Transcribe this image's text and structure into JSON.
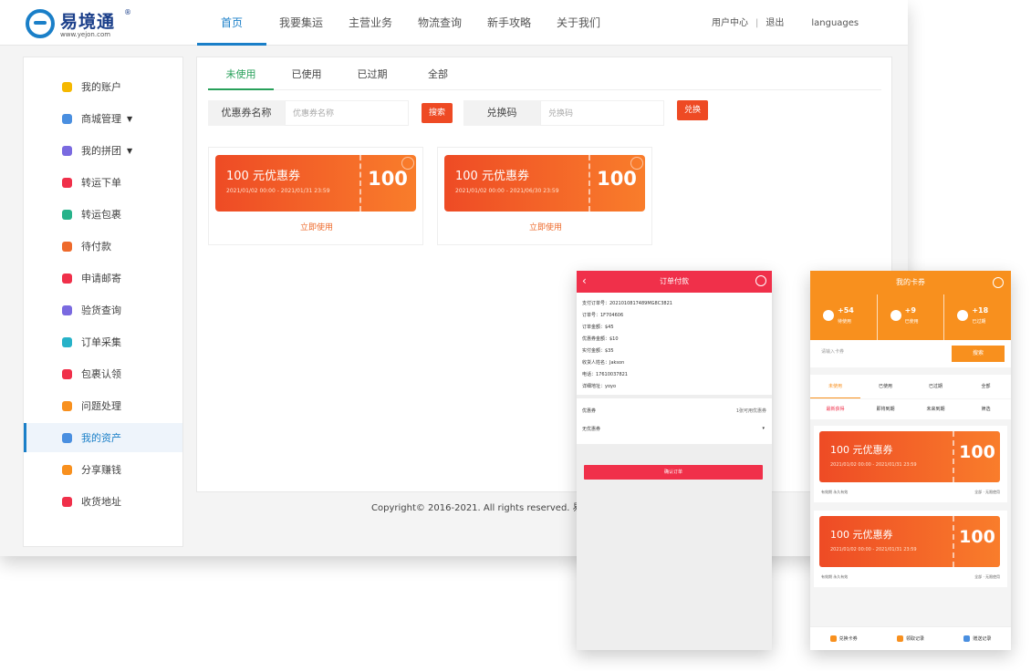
{
  "colors": {
    "brand": "#1a7fc8",
    "active_tab": "#27a05a",
    "accent_red": "#ee4a24",
    "mobile_red": "#f0304a",
    "mobile_orange": "#f8901e"
  },
  "header": {
    "logo_text": "易境通",
    "logo_reg": "®",
    "logo_url": "www.yejon.com",
    "nav": [
      "首页",
      "我要集运",
      "主营业务",
      "物流查询",
      "新手攻略",
      "关于我们"
    ],
    "user_center": "用户中心",
    "separator": "|",
    "logout": "退出",
    "languages": "languages"
  },
  "sidebar": {
    "items": [
      {
        "label": "我的账户",
        "icon": "user-icon",
        "color": "#f5b800"
      },
      {
        "label": "商城管理",
        "icon": "shop-icon",
        "color": "#4a8fe0",
        "dropdown": "▼"
      },
      {
        "label": "我的拼团",
        "icon": "group-icon",
        "color": "#7a6ae0",
        "dropdown": "▼"
      },
      {
        "label": "转运下单",
        "icon": "order-icon",
        "color": "#f0304a"
      },
      {
        "label": "转运包裹",
        "icon": "package-icon",
        "color": "#27b28a"
      },
      {
        "label": "待付款",
        "icon": "payment-icon",
        "color": "#ee6a2b"
      },
      {
        "label": "申请邮寄",
        "icon": "mail-icon",
        "color": "#f0304a"
      },
      {
        "label": "验货查询",
        "icon": "inspect-icon",
        "color": "#7a6ae0"
      },
      {
        "label": "订单采集",
        "icon": "collect-icon",
        "color": "#27b2c8"
      },
      {
        "label": "包裹认领",
        "icon": "claim-icon",
        "color": "#f0304a"
      },
      {
        "label": "问题处理",
        "icon": "issue-icon",
        "color": "#f8901e"
      },
      {
        "label": "我的资产",
        "icon": "assets-icon",
        "color": "#4a8fe0"
      },
      {
        "label": "分享赚钱",
        "icon": "share-icon",
        "color": "#f8901e"
      },
      {
        "label": "收货地址",
        "icon": "address-icon",
        "color": "#f0304a"
      }
    ]
  },
  "coupons_page": {
    "tabs": [
      "未使用",
      "已使用",
      "已过期",
      "全部"
    ],
    "search_label": "优惠券名称",
    "search_placeholder": "优惠券名称",
    "search_button": "搜索",
    "redeem_label": "兑换码",
    "redeem_placeholder": "兑换码",
    "redeem_button": "兑换",
    "cards": [
      {
        "title": "100 元优惠券",
        "date": "2021/01/02 00:00 - 2021/01/31 23:59",
        "value": "100",
        "action": "立即使用"
      },
      {
        "title": "100 元优惠券",
        "date": "2021/01/02 00:00 - 2021/06/30 23:59",
        "value": "100",
        "action": "立即使用"
      }
    ]
  },
  "footer": {
    "copyright": "Copyright© 2016-2021. All rights reserved. 易境"
  },
  "mobile_order": {
    "title": "订单付款",
    "back": "‹",
    "rows": [
      "支付订单号：2021010817489MG8C3821",
      "订单号：1F704606",
      "订单金额：$45",
      "优惠券金额：$10",
      "实付金额：$35",
      "收货人姓名：Jakson",
      "电话：17610037821",
      "详细地址：yoyo"
    ],
    "coupon_label": "优惠券",
    "coupon_hint": "1张可用优惠券",
    "select_value": "无优惠券",
    "select_arrow": "▾",
    "confirm_button": "确认订单"
  },
  "mobile_coupons": {
    "title": "我的卡券",
    "stats": [
      {
        "value": "+54",
        "label": "待使用"
      },
      {
        "value": "+9",
        "label": "已使用"
      },
      {
        "value": "+18",
        "label": "已过期"
      }
    ],
    "search_placeholder": "请输入卡券",
    "search_button": "搜索",
    "tabs": [
      "未使用",
      "已使用",
      "已过期",
      "全部"
    ],
    "subtabs": [
      "最新获得",
      "即将到期",
      "未来到期",
      "筛选"
    ],
    "cards": [
      {
        "title": "100 元优惠券",
        "date": "2021/01/02 00:00 - 2021/01/31 23:59",
        "value": "100",
        "footer_left": "有效期 永久有效",
        "footer_right": "全部 · 无限使用"
      },
      {
        "title": "100 元优惠券",
        "date": "2021/01/02 00:00 - 2021/01/31 23:59",
        "value": "100",
        "footer_left": "有效期 永久有效",
        "footer_right": "全部 · 无限使用"
      }
    ],
    "bottom": [
      {
        "label": "兑换卡券",
        "color": "#f8901e"
      },
      {
        "label": "领取记录",
        "color": "#f8901e"
      },
      {
        "label": "赠送记录",
        "color": "#4a8fe0"
      }
    ]
  }
}
